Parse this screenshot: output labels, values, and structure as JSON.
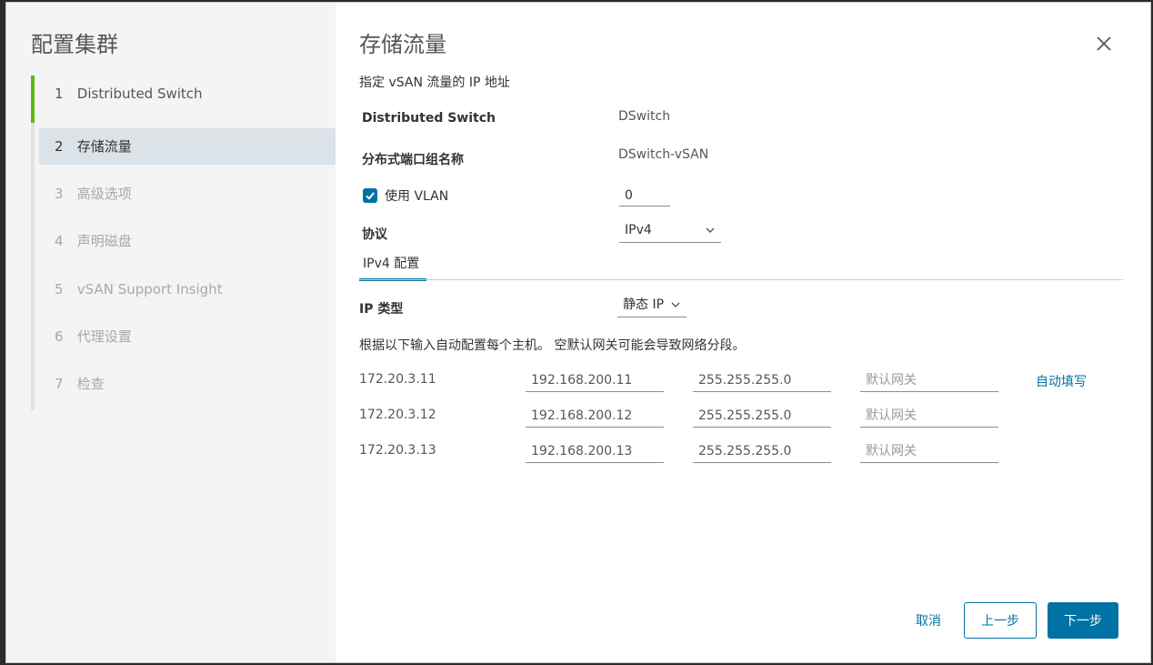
{
  "sidebar": {
    "title": "配置集群",
    "steps": [
      {
        "num": "1",
        "label": "Distributed Switch",
        "state": "done"
      },
      {
        "num": "2",
        "label": "存储流量",
        "state": "active"
      },
      {
        "num": "3",
        "label": "高级选项",
        "state": "todo"
      },
      {
        "num": "4",
        "label": "声明磁盘",
        "state": "todo"
      },
      {
        "num": "5",
        "label": "vSAN Support Insight",
        "state": "todo"
      },
      {
        "num": "6",
        "label": "代理设置",
        "state": "todo"
      },
      {
        "num": "7",
        "label": "检查",
        "state": "todo"
      }
    ]
  },
  "main": {
    "title": "存储流量",
    "subtitle": "指定 vSAN 流量的 IP 地址",
    "switch_label": "Distributed Switch",
    "switch_value": "DSwitch",
    "portgroup_label": "分布式端口组名称",
    "portgroup_value": "DSwitch-vSAN",
    "vlan_label": "使用 VLAN",
    "vlan_checked": true,
    "vlan_value": "0",
    "protocol_label": "协议",
    "protocol_value": "IPv4",
    "tab_label": "IPv4 配置",
    "iptype_label": "IP 类型",
    "iptype_value": "静态 IP",
    "hint": "根据以下输入自动配置每个主机。 空默认网关可能会导致网络分段。",
    "autofill_label": "自动填写",
    "gateway_placeholder": "默认网关",
    "hosts": [
      {
        "host": "172.20.3.11",
        "ip": "192.168.200.11",
        "mask": "255.255.255.0",
        "gateway": ""
      },
      {
        "host": "172.20.3.12",
        "ip": "192.168.200.12",
        "mask": "255.255.255.0",
        "gateway": ""
      },
      {
        "host": "172.20.3.13",
        "ip": "192.168.200.13",
        "mask": "255.255.255.0",
        "gateway": ""
      }
    ]
  },
  "footer": {
    "cancel_label": "取消",
    "prev_label": "上一步",
    "next_label": "下一步"
  },
  "colors": {
    "accent": "#0072a3",
    "done_step": "#60b515",
    "active_step_bg": "#dbe2e8"
  },
  "icons": {
    "close": "close-icon",
    "checkbox": "check-icon",
    "dropdown": "chevron-down-icon"
  }
}
